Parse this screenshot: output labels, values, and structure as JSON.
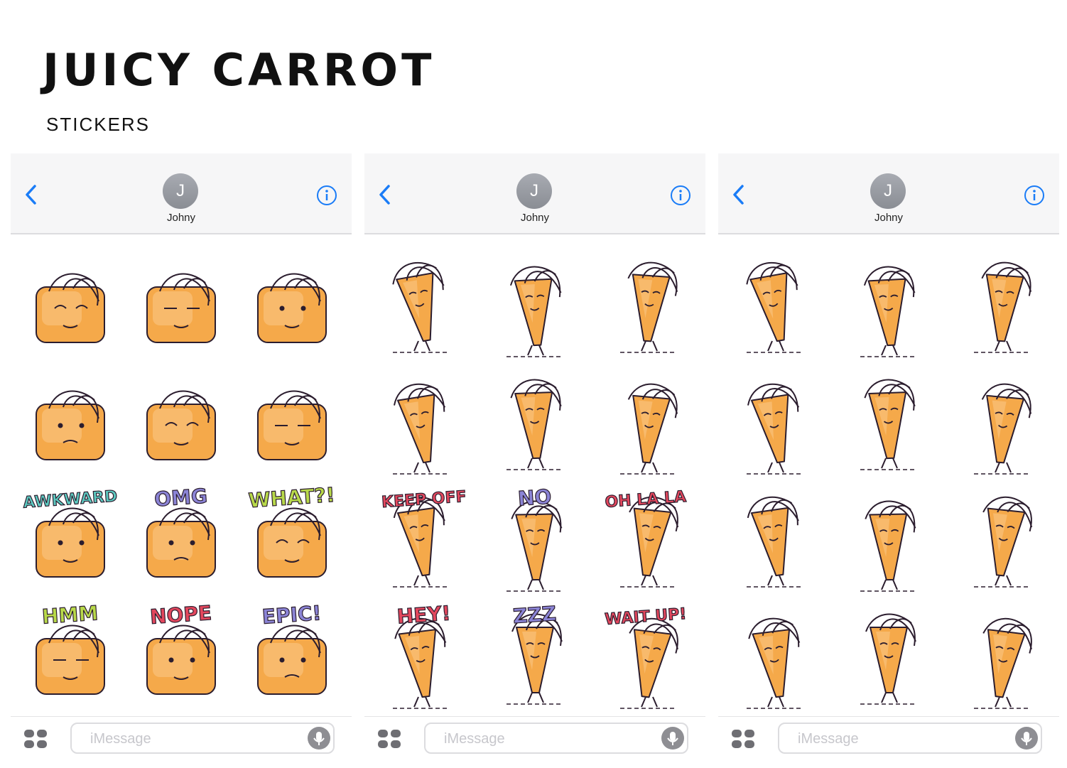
{
  "page": {
    "title": "JUICY CARROT",
    "subtitle": "STICKERS"
  },
  "colors": {
    "carrot": "#f5a94a",
    "carrot_light": "#f9c27a",
    "ios_blue": "#1a7cf7",
    "label_teal": "#5cc9c0",
    "label_purple": "#8b84d6",
    "label_red": "#e3475d",
    "label_green": "#b8d94a",
    "moon": "#f3cf59"
  },
  "phones": [
    {
      "nav": {
        "avatar_initial": "J",
        "contact_name": "Johny",
        "back_icon": "chevron-left-icon",
        "info_icon": "info-icon"
      },
      "stickers": [
        {
          "label": ""
        },
        {
          "label": ""
        },
        {
          "label": ""
        },
        {
          "label": ""
        },
        {
          "label": ""
        },
        {
          "label": ""
        },
        {
          "label": "AWKWARD"
        },
        {
          "label": "OMG"
        },
        {
          "label": "WHAT?!"
        },
        {
          "label": "HMM"
        },
        {
          "label": "NOPE"
        },
        {
          "label": "EPIC!"
        }
      ],
      "input": {
        "placeholder": "iMessage",
        "apps_icon": "app-drawer-icon",
        "mic_icon": "microphone-icon"
      }
    },
    {
      "nav": {
        "avatar_initial": "J",
        "contact_name": "Johny",
        "back_icon": "chevron-left-icon",
        "info_icon": "info-icon"
      },
      "stickers": [
        {
          "label": ""
        },
        {
          "label": ""
        },
        {
          "label": ""
        },
        {
          "label": ""
        },
        {
          "label": ""
        },
        {
          "label": ""
        },
        {
          "label": "KEEP OFF"
        },
        {
          "label": "NO"
        },
        {
          "label": "OH LA LA"
        },
        {
          "label": "HEY!"
        },
        {
          "label": "ZZZ"
        },
        {
          "label": "WAIT UP!"
        }
      ],
      "input": {
        "placeholder": "iMessage",
        "apps_icon": "app-drawer-icon",
        "mic_icon": "microphone-icon"
      }
    },
    {
      "nav": {
        "avatar_initial": "J",
        "contact_name": "Johny",
        "back_icon": "chevron-left-icon",
        "info_icon": "info-icon"
      },
      "stickers": [
        {
          "label": ""
        },
        {
          "label": ""
        },
        {
          "label": ""
        },
        {
          "label": ""
        },
        {
          "label": ""
        },
        {
          "label": ""
        },
        {
          "label": ""
        },
        {
          "label": ""
        },
        {
          "label": ""
        },
        {
          "label": ""
        },
        {
          "label": ""
        },
        {
          "label": ""
        }
      ],
      "input": {
        "placeholder": "iMessage",
        "apps_icon": "app-drawer-icon",
        "mic_icon": "microphone-icon"
      }
    }
  ]
}
